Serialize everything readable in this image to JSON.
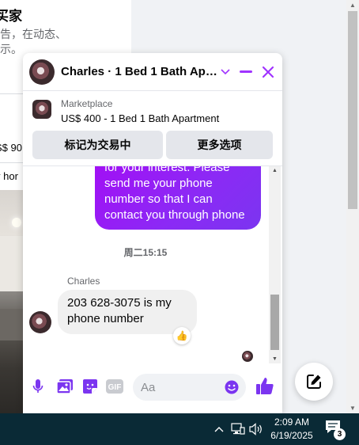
{
  "background_page": {
    "title": "买家",
    "subtitle_line1": "告，在动态、",
    "subtitle_line2": "示。",
    "price_partial": "S$ 90",
    "desc_partial": "y hor"
  },
  "chat": {
    "title": "Charles · 1 Bed 1 Bath Apar...",
    "listing": {
      "source": "Marketplace",
      "title": "US$ 400 - 1 Bed 1 Bath Apartment",
      "mark_button": "标记为交易中",
      "more_button": "更多选项"
    },
    "outgoing_message_lines": [
      "for your interest. Please",
      "send me your phone",
      "number so that I can",
      "contact you through phone"
    ],
    "timestamp": "周二15:15",
    "sender_name": "Charles",
    "incoming_message_lines": [
      "203 628-3075 is my",
      "phone number"
    ],
    "reaction": "👍",
    "composer": {
      "placeholder": "Aa",
      "gif_label": "GIF"
    },
    "accent_color": "#a033ff"
  },
  "taskbar": {
    "time": "2:09 AM",
    "date": "6/19/2025",
    "notification_count": "3"
  }
}
